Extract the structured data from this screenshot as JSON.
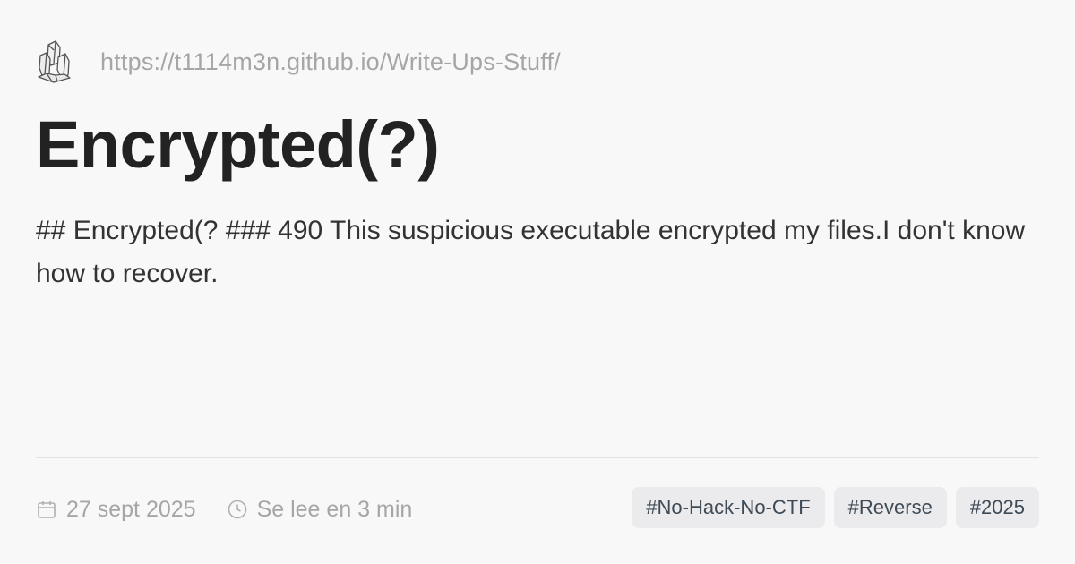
{
  "header": {
    "logo_icon": "crystal-logo-icon",
    "site_url": "https://t1114m3n.github.io/Write-Ups-Stuff/"
  },
  "post": {
    "title": "Encrypted(?)",
    "description": "## Encrypted(? ### 490 This suspicious executable encrypted my files.I don't know how to recover."
  },
  "meta": {
    "date_icon": "calendar-icon",
    "date": "27 sept 2025",
    "reading_icon": "clock-icon",
    "reading_time": "Se lee en 3 min"
  },
  "tags": [
    "#No-Hack-No-CTF",
    "#Reverse",
    "#2025"
  ],
  "colors": {
    "background": "#f9f8f9",
    "title": "#222222",
    "muted": "#a6a6a6",
    "tag_background": "#ebebed",
    "tag_text": "#3e4a56"
  }
}
